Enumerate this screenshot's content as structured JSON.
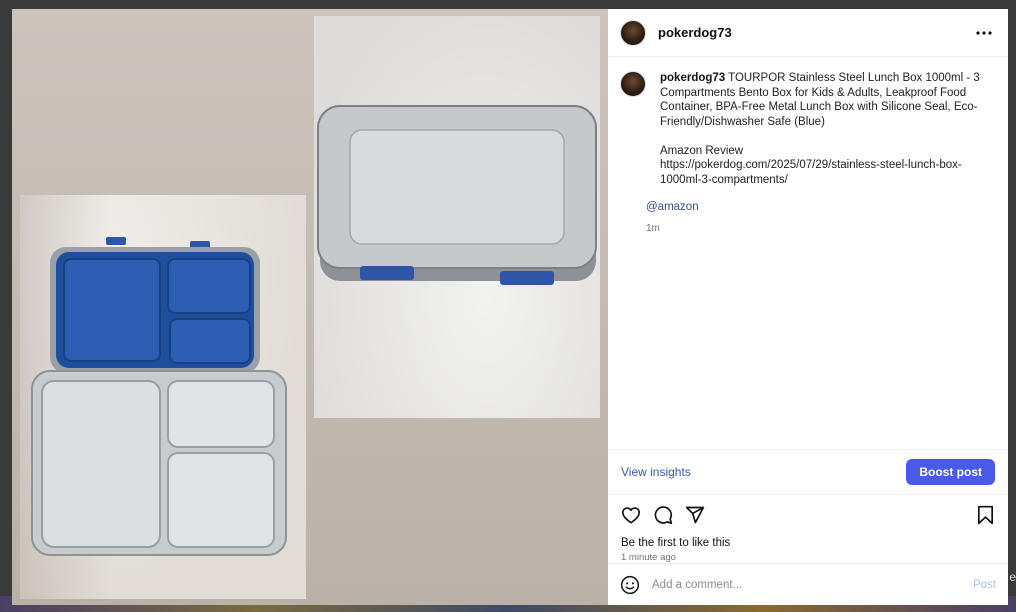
{
  "post": {
    "username": "pokerdog73",
    "more_icon": "more-horizontal-icon"
  },
  "caption": {
    "username": "pokerdog73",
    "text": " TOURPOR Stainless Steel Lunch Box 1000ml - 3 Compartments Bento Box for Kids & Adults, Leakproof Food Container, BPA-Free Metal Lunch Box with Silicone Seal, Eco-Friendly/Dishwasher Safe (Blue)\n\nAmazon Review\nhttps://pokerdog.com/2025/07/29/stainless-steel-lunch-box-1000ml-3-compartments/",
    "mention": "@amazon",
    "age": "1m"
  },
  "insights": {
    "view_label": "View insights",
    "boost_label": "Boost post"
  },
  "actions": {
    "like_icon": "heart-icon",
    "comment_icon": "comment-icon",
    "share_icon": "send-icon",
    "save_icon": "bookmark-icon"
  },
  "likes_text": "Be the first to like this",
  "timestamp": "1 minute ago",
  "comment_box": {
    "placeholder": "Add a comment...",
    "post_label": "Post",
    "emoji_icon": "emoji-icon"
  },
  "background": {
    "stray_text": "e"
  },
  "colors": {
    "accent": "#4a5ae8",
    "link": "#385185",
    "post_disabled": "#a7c0f2"
  }
}
